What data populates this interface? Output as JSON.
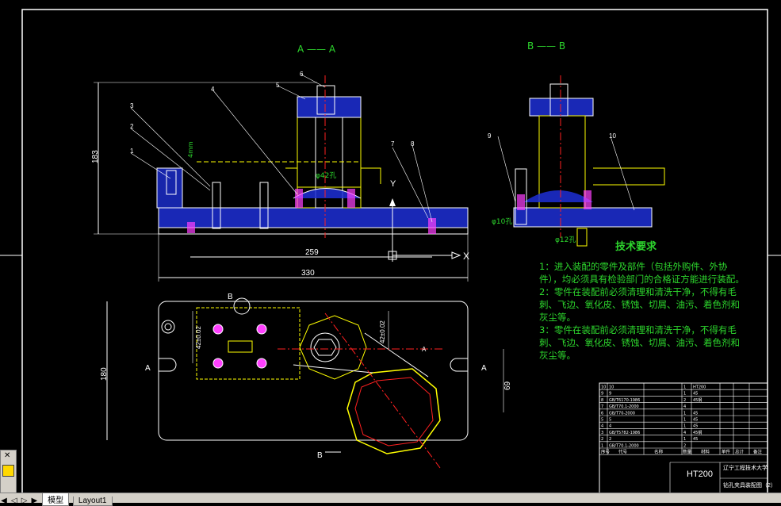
{
  "views": {
    "section_a": "A —— A",
    "section_b": "B —— B"
  },
  "dimensions": {
    "overall_height": "183",
    "d42": "φ42孔",
    "len_259": "259",
    "len_330": "330",
    "plan_height": "180",
    "plan_42a": "42±0.02",
    "plan_42b": "42±0.02",
    "plan_69": "69",
    "d10": "φ10孔",
    "d12": "φ12孔",
    "small_left": "4mm"
  },
  "callouts": [
    "1",
    "2",
    "3",
    "4",
    "5",
    "6",
    "7",
    "8",
    "9",
    "10"
  ],
  "section_marks": {
    "a_left": "A",
    "a_right": "A",
    "a_mid": "A",
    "b_top": "B",
    "b_bottom": "B"
  },
  "axis": {
    "y": "Y",
    "x": "X"
  },
  "tech_requirements": {
    "title": "技术要求",
    "items": [
      "1：进入装配的零件及部件（包括外购件、外协件），均必须具有检验部门的合格证方能进行装配。",
      "2：零件在装配前必须清理和清洗干净，不得有毛刺、飞边、氧化皮、锈蚀、切屑、油污、着色剂和灰尘等。",
      "3：零件在装配前必须清理和清洗干净，不得有毛刺、飞边、氧化皮、锈蚀、切屑、油污、着色剂和灰尘等。"
    ]
  },
  "title_block": {
    "material": "HT200",
    "school": "辽宁工程技术大学",
    "drawing_name": "钻孔夹具装配图（2）",
    "headers": [
      "序号",
      "代号",
      "名称",
      "数量",
      "材料",
      "单件",
      "总计",
      "备注"
    ],
    "rows": [
      {
        "no": "10",
        "code": "10",
        "name": "",
        "qty": "1",
        "mat": "HT200"
      },
      {
        "no": "9",
        "code": "9",
        "name": "",
        "qty": "1",
        "mat": "45"
      },
      {
        "no": "8",
        "code": "GB/T6170-1986",
        "name": "",
        "qty": "2",
        "mat": "45钢"
      },
      {
        "no": "7",
        "code": "GB/T70.1-2000",
        "name": "",
        "qty": "4",
        "mat": ""
      },
      {
        "no": "6",
        "code": "GB/T70-2000",
        "name": "",
        "qty": "1",
        "mat": "45"
      },
      {
        "no": "5",
        "code": "5",
        "name": "",
        "qty": "1",
        "mat": "45"
      },
      {
        "no": "4",
        "code": "4",
        "name": "",
        "qty": "1",
        "mat": "45"
      },
      {
        "no": "3",
        "code": "GB/T5782-1986",
        "name": "",
        "qty": "4",
        "mat": "45钢"
      },
      {
        "no": "2",
        "code": "2",
        "name": "",
        "qty": "1",
        "mat": "45"
      },
      {
        "no": "1",
        "code": "GB/T70.1-2000",
        "name": "",
        "qty": "2",
        "mat": ""
      }
    ]
  },
  "ui": {
    "tab_model": "模型",
    "tab_layout": "Layout1",
    "nav_first": "◀",
    "nav_prev": "◁",
    "nav_next": "▷",
    "nav_last": "▶",
    "tool_close": "✕"
  },
  "colors": {
    "background": "#000000",
    "outline": "#ffffff",
    "part": "#ffff00",
    "hatch": "#2a3cff",
    "leader": "#ffffff",
    "dim": "#ffffff",
    "center": "#ff2020",
    "bolt": "#ff40ff",
    "text": "#2dd62d"
  }
}
